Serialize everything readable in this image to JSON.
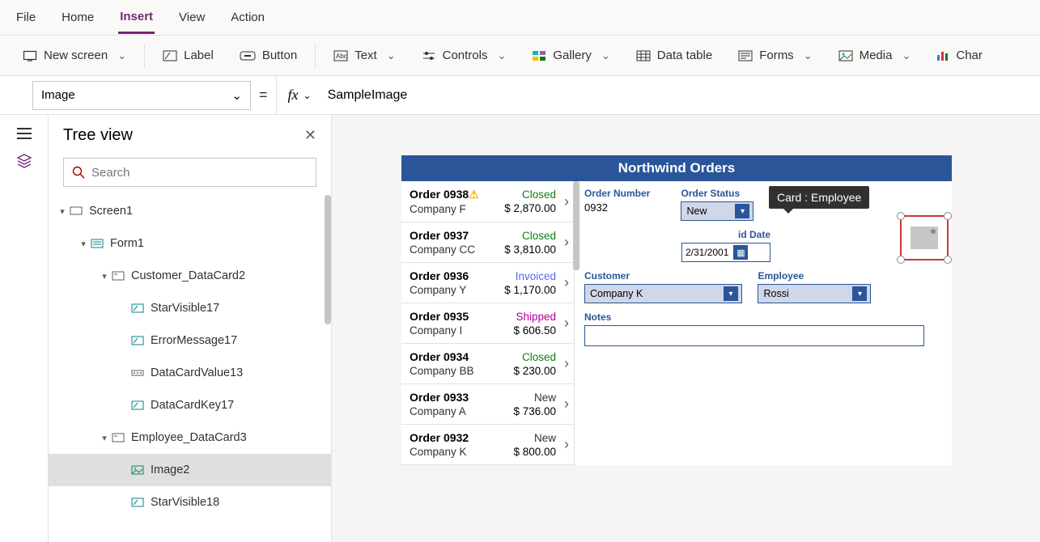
{
  "menu": {
    "file": "File",
    "home": "Home",
    "insert": "Insert",
    "view": "View",
    "action": "Action"
  },
  "ribbon": {
    "new_screen": "New screen",
    "label": "Label",
    "button": "Button",
    "text": "Text",
    "controls": "Controls",
    "gallery": "Gallery",
    "data_table": "Data table",
    "forms": "Forms",
    "media": "Media",
    "charts": "Char"
  },
  "formula": {
    "property": "Image",
    "value": "SampleImage",
    "fx": "fx"
  },
  "treepanel": {
    "title": "Tree view",
    "search_placeholder": "Search",
    "nodes": {
      "screen1": "Screen1",
      "form1": "Form1",
      "customer_dc": "Customer_DataCard2",
      "starvis17": "StarVisible17",
      "errmsg17": "ErrorMessage17",
      "dcval13": "DataCardValue13",
      "dckey17": "DataCardKey17",
      "employee_dc": "Employee_DataCard3",
      "image2": "Image2",
      "starvis18": "StarVisible18"
    }
  },
  "app": {
    "title": "Northwind Orders",
    "orders": [
      {
        "name": "Order 0938",
        "warn": true,
        "company": "Company F",
        "status": "Closed",
        "amount": "$ 2,870.00"
      },
      {
        "name": "Order 0937",
        "warn": false,
        "company": "Company CC",
        "status": "Closed",
        "amount": "$ 3,810.00"
      },
      {
        "name": "Order 0936",
        "warn": false,
        "company": "Company Y",
        "status": "Invoiced",
        "amount": "$ 1,170.00"
      },
      {
        "name": "Order 0935",
        "warn": false,
        "company": "Company I",
        "status": "Shipped",
        "amount": "$ 606.50"
      },
      {
        "name": "Order 0934",
        "warn": false,
        "company": "Company BB",
        "status": "Closed",
        "amount": "$ 230.00"
      },
      {
        "name": "Order 0933",
        "warn": false,
        "company": "Company A",
        "status": "New",
        "amount": "$ 736.00"
      },
      {
        "name": "Order 0932",
        "warn": false,
        "company": "Company K",
        "status": "New",
        "amount": "$ 800.00"
      }
    ],
    "form": {
      "order_number_label": "Order Number",
      "order_number": "0932",
      "order_status_label": "Order Status",
      "order_status": "New",
      "paid_date_label": "id Date",
      "paid_date": "2/31/2001",
      "customer_label": "Customer",
      "customer": "Company K",
      "employee_label": "Employee",
      "employee": "Rossi",
      "notes_label": "Notes"
    },
    "tooltip": "Card : Employee"
  }
}
